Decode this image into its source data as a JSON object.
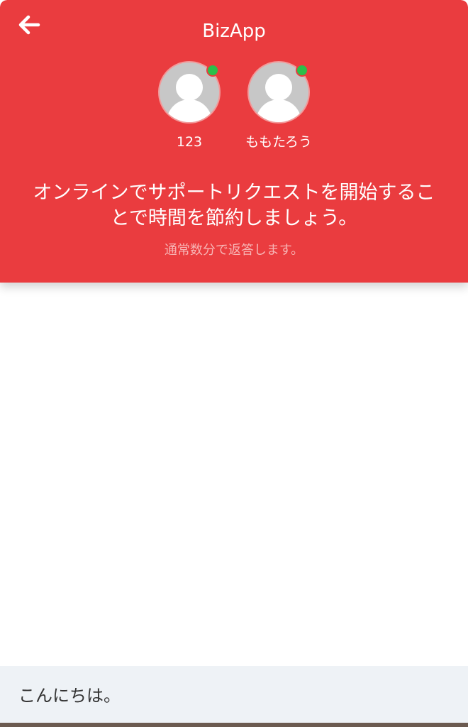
{
  "header": {
    "title": "BizApp",
    "background_color": "#EA3C3F",
    "back_icon": "arrow-left-icon"
  },
  "agents": [
    {
      "name": "123",
      "online": true
    },
    {
      "name": "ももたろう",
      "online": true
    }
  ],
  "intro": {
    "message": "オンラインでサポートリクエストを開始することで時間を節約しましょう。",
    "response_time": "通常数分で返答します。"
  },
  "composer": {
    "value": "こんにちは。"
  },
  "colors": {
    "online": "#2BBF4A",
    "composer_bg": "#EEF2F6"
  }
}
